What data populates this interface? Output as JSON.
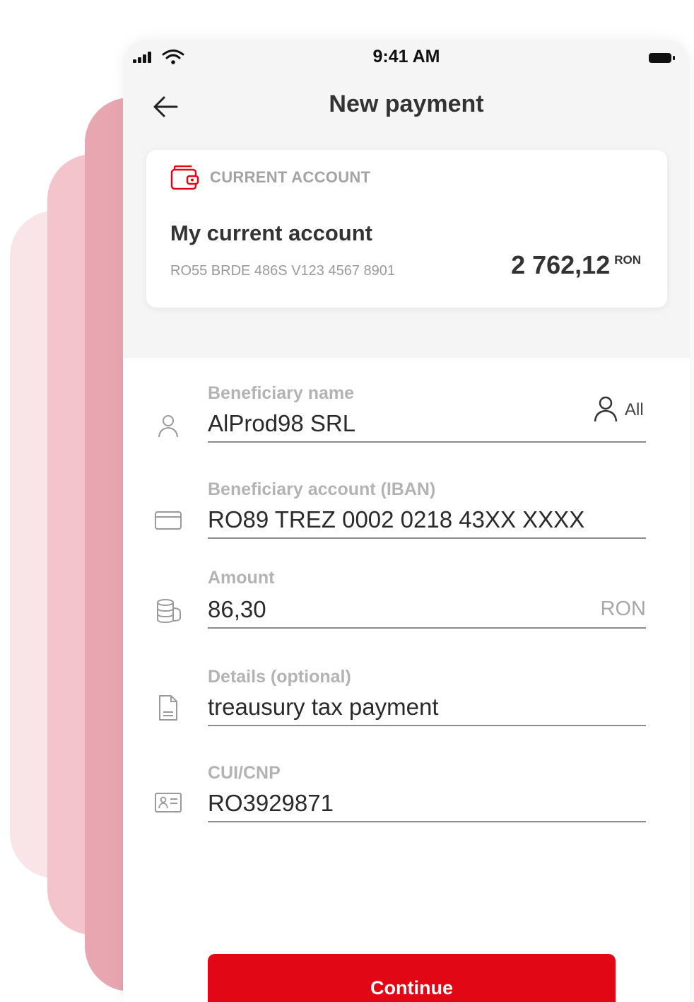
{
  "status_bar": {
    "time": "9:41 AM"
  },
  "header": {
    "title": "New payment"
  },
  "account": {
    "type_label": "CURRENT ACCOUNT",
    "name": "My current account",
    "iban": "RO55 BRDE 486S V123 4567 8901",
    "balance": "2 762,12",
    "currency": "RON"
  },
  "form": {
    "beneficiary_name": {
      "label": "Beneficiary name",
      "value": "AlProd98 SRL",
      "contacts_label": "All"
    },
    "beneficiary_iban": {
      "label": "Beneficiary account (IBAN)",
      "value": "RO89 TREZ 0002 0218 43XX XXXX"
    },
    "amount": {
      "label": "Amount",
      "value": "86,30",
      "currency": "RON"
    },
    "details": {
      "label": "Details (optional)",
      "value": "treausury tax payment"
    },
    "cui_cnp": {
      "label": "CUI/CNP",
      "value": "RO3929871"
    }
  },
  "continue_label": "Continue",
  "colors": {
    "accent": "#e20714",
    "decor_light": "#f9e4e7",
    "decor_mid": "#f4c4cc",
    "decor_dark": "#e8a6b1"
  },
  "icons": [
    "back-arrow-icon",
    "wallet-icon",
    "person-icon",
    "card-icon",
    "coins-icon",
    "document-icon",
    "id-card-icon",
    "contacts-icon"
  ]
}
